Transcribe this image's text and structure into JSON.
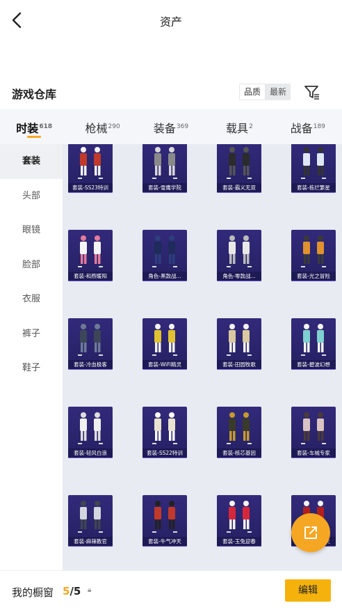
{
  "header": {
    "title": "资产"
  },
  "warehouse": {
    "title": "游戏仓库",
    "sort_options": [
      "品质",
      "最新"
    ]
  },
  "tabs": [
    {
      "label": "时装",
      "count": "618"
    },
    {
      "label": "枪械",
      "count": "290"
    },
    {
      "label": "装备",
      "count": "369"
    },
    {
      "label": "载具",
      "count": "2"
    },
    {
      "label": "战备",
      "count": "189"
    }
  ],
  "side_items": [
    "套装",
    "头部",
    "眼镜",
    "脸部",
    "衣服",
    "裤子",
    "鞋子"
  ],
  "items": [
    "套装-SS23特训",
    "套装-雪鹰学院",
    "套装-霸义无双",
    "套装-栋烂繁星",
    "套装-和煦暖阳",
    "角色-黑款战...",
    "角色-零款战...",
    "套装-光之冒险",
    "套装-冷血极客",
    "套装-WiFi精灵",
    "套装-田园牧歌",
    "套装-碧波幻想",
    "套装-轻风白浪",
    "套装-SS22特训",
    "套装-核芯基因",
    "套装-车械专家",
    "套装-麻辣教官",
    "套装-牛气冲天",
    "套装-玉兔迎春",
    "套装-中国之火",
    "",
    "",
    "",
    ""
  ],
  "bottom": {
    "label": "我的橱窗",
    "current": "5",
    "separator": "/",
    "total": "5",
    "edit_label": "编辑"
  },
  "colors": {
    "accent": "#f5a623",
    "card_bg": "#2b246e",
    "grid_bg": "#e8ebf1"
  }
}
